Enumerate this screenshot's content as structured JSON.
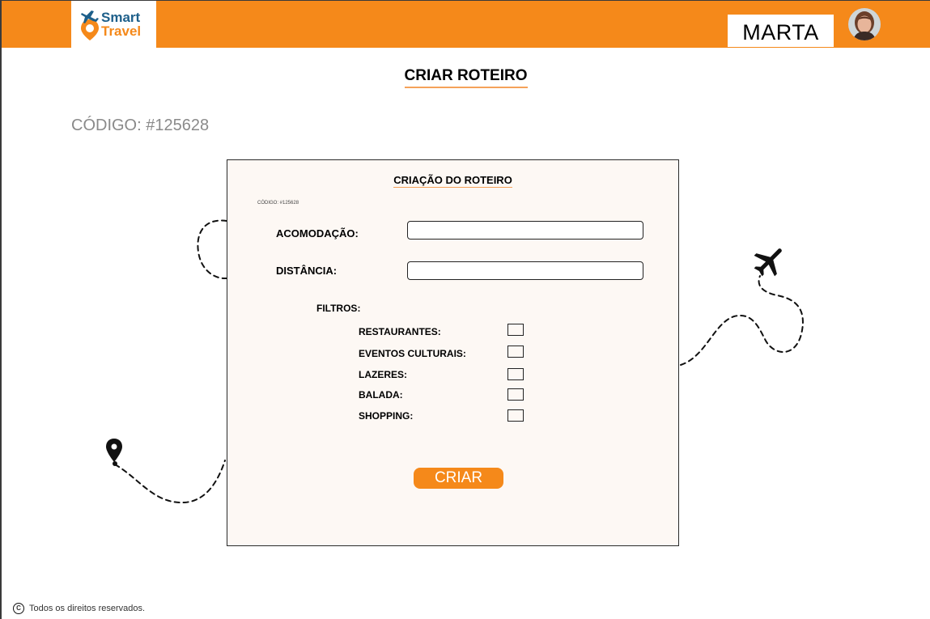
{
  "header": {
    "logo_line1": "Smart",
    "logo_line2": "Travel",
    "user_name": "MARTA"
  },
  "page": {
    "title": "CRIAR ROTEIRO",
    "codigo": "CÓDIGO: #125628"
  },
  "card": {
    "title": "CRIAÇÃO DO ROTEIRO",
    "codigo": "CÓDIGO: #125628",
    "fields": {
      "acomodacao_label": "ACOMODAÇÃO:",
      "acomodacao_value": "",
      "distancia_label": "DISTÂNCIA:",
      "distancia_value": ""
    },
    "filtros_label": "FILTROS:",
    "filters": [
      {
        "label": "RESTAURANTES:",
        "checked": false
      },
      {
        "label": "EVENTOS CULTURAIS:",
        "checked": false
      },
      {
        "label": "LAZERES:",
        "checked": false
      },
      {
        "label": "BALADA:",
        "checked": false
      },
      {
        "label": "SHOPPING:",
        "checked": false
      }
    ],
    "submit_label": "CRIAR"
  },
  "footer": {
    "copyright_symbol": "C",
    "text": "Todos os direitos reservados."
  },
  "icons": {
    "logo": "plane-pin-logo-icon",
    "avatar": "user-avatar",
    "airplane": "airplane-icon",
    "map_pin": "map-pin-icon",
    "copyright": "copyright-icon"
  },
  "colors": {
    "accent": "#f5891a",
    "brand_blue": "#1d5f8a",
    "card_background": "#fdf8f4",
    "muted_text": "#8a8a8a"
  }
}
